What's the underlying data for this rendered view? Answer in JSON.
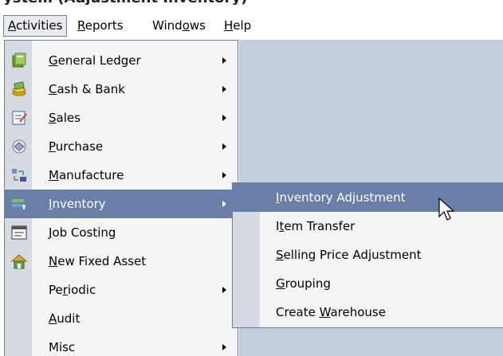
{
  "menubar": {
    "items": [
      {
        "label": "Activities",
        "mnemonic": "A"
      },
      {
        "label": "Reports",
        "mnemonic": "R"
      },
      {
        "label": "Windows",
        "mnemonic": "o"
      },
      {
        "label": "Help",
        "mnemonic": "H"
      }
    ]
  },
  "activities_menu": {
    "items": [
      {
        "label": "General Ledger",
        "icon": "ledger-icon",
        "submenu": true
      },
      {
        "label": "Cash & Bank",
        "icon": "cash-bank-icon",
        "submenu": true
      },
      {
        "label": "Sales",
        "icon": "sales-icon",
        "submenu": true
      },
      {
        "label": "Purchase",
        "icon": "purchase-icon",
        "submenu": true
      },
      {
        "label": "Manufacture",
        "icon": "manufacture-icon",
        "submenu": true
      },
      {
        "label": "Inventory",
        "icon": "inventory-icon",
        "submenu": true,
        "highlighted": true
      },
      {
        "label": "Job Costing",
        "icon": "job-costing-icon",
        "submenu": false
      },
      {
        "label": "New Fixed Asset",
        "icon": "fixed-asset-icon",
        "submenu": false
      },
      {
        "label": "Periodic",
        "icon": "",
        "submenu": true
      },
      {
        "label": "Audit",
        "icon": "",
        "submenu": false
      },
      {
        "label": "Misc",
        "icon": "",
        "submenu": true
      }
    ]
  },
  "inventory_submenu": {
    "items": [
      {
        "label": "Inventory Adjustment",
        "highlighted": true
      },
      {
        "label": "Item Transfer"
      },
      {
        "label": "Selling Price Adjustment"
      },
      {
        "label": "Grouping"
      },
      {
        "label": "Create Warehouse"
      }
    ]
  },
  "colors": {
    "highlight": "#6a7fa8",
    "workspace": "#c3cddc",
    "menu_bg": "#f5f5f5",
    "gutter": "#d6dbe3"
  }
}
